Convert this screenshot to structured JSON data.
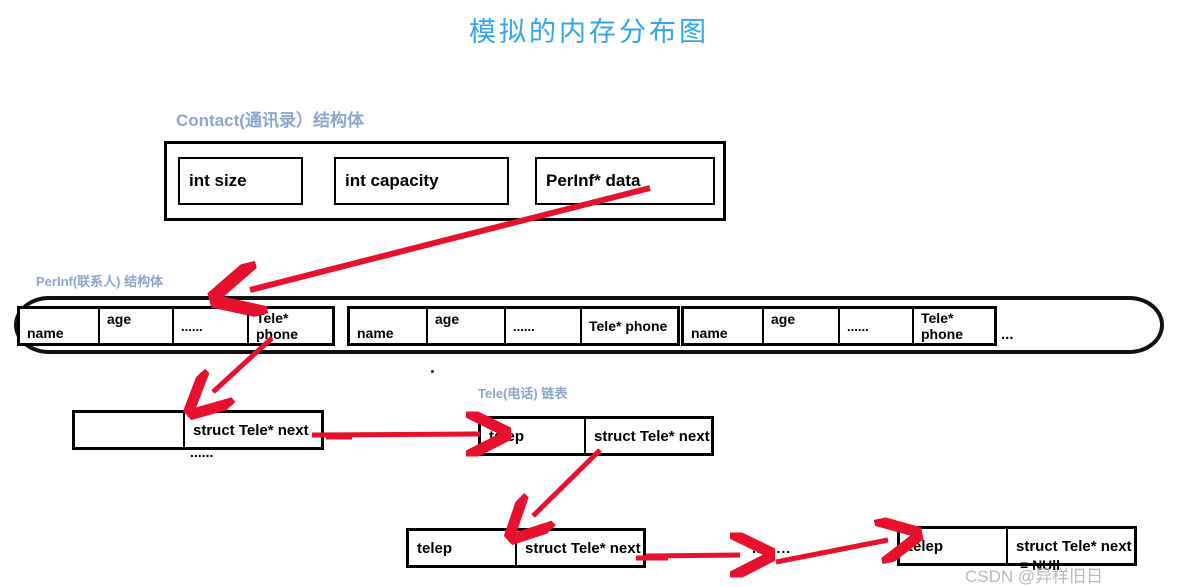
{
  "title": "模拟的内存分布图",
  "labels": {
    "contact": "Contact(通讯录）结构体",
    "perinf": "PerInf(联系人) 结构体",
    "tele": "Tele(电话) 链表"
  },
  "colors": {
    "title": "#2fa8e8",
    "section_label": "#8fa5cf",
    "arrow": "#e8112d",
    "box_border": "#000000",
    "watermark": "#b9b9b9"
  },
  "contact_struct": {
    "fields": [
      {
        "label": "int size"
      },
      {
        "label": "int capacity"
      },
      {
        "label": "PerInf* data"
      }
    ]
  },
  "perinf_array": {
    "records": [
      {
        "name": "name",
        "age": "age",
        "dots": "......",
        "phone": "Tele* phone"
      },
      {
        "name": "name",
        "age": "age",
        "dots": "......",
        "phone": "Tele* phone"
      },
      {
        "name": "name",
        "age": "age",
        "dots": "......",
        "phone": "Tele* phone"
      }
    ],
    "ellipsis": "..."
  },
  "tele_list": {
    "node1": {
      "head": "",
      "tail": "struct Tele* next",
      "subtext": "......"
    },
    "node2": {
      "head": "telep",
      "tail": "struct Tele* next"
    },
    "node3": {
      "head": "telep",
      "tail": "struct Tele* next"
    },
    "node4": {
      "head": "telep",
      "tail": "struct Tele* next",
      "subtext": "= NUll"
    },
    "mid_dots": "........"
  },
  "watermark": "CSDN @异样旧日"
}
